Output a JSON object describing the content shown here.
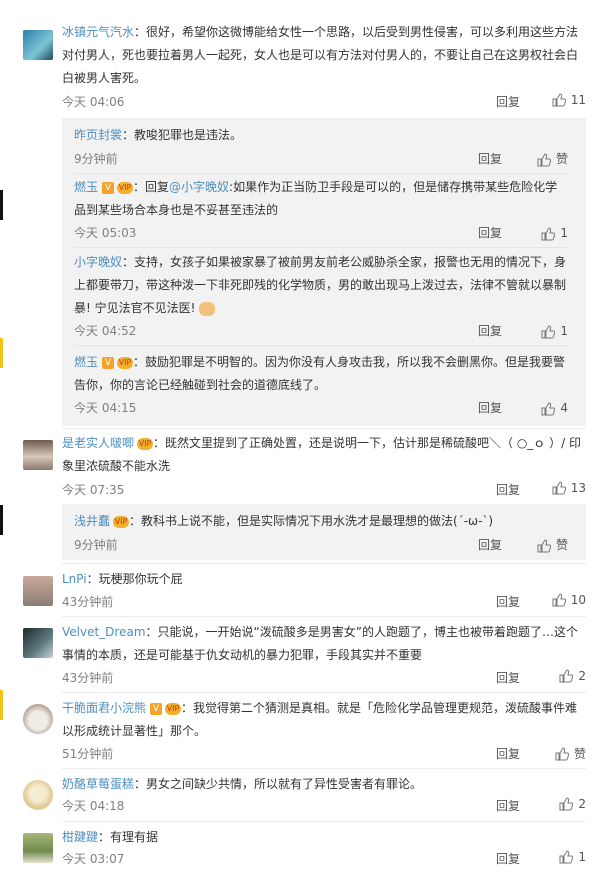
{
  "ui": {
    "reply": "回复",
    "zan": "赞"
  },
  "comments": [
    {
      "name": "冰镇元气汽水",
      "text": "：很好，希望你这微博能给女性一个思路，以后受到男性侵害，可以多利用这些方法对付男人，死也要拉着男人一起死，女人也是可以有方法对付男人的，不要让自己在这男权社会白白被男人害死。",
      "time": "今天 04:06",
      "likes": "11",
      "replies": [
        {
          "name": "昨页封裳",
          "text": "：教唆犯罪也是违法。",
          "time": "9分钟前",
          "likes": "赞"
        },
        {
          "name": "燃玉",
          "text": "：回复",
          "mention": "@小字晚奴",
          "text2": ":如果作为正当防卫手段是可以的，但是储存携带某些危险化学品到某些场合本身也是不妥甚至违法的",
          "time": "今天 05:03",
          "likes": "1"
        },
        {
          "name": "小字晚奴",
          "text": "：支持，女孩子如果被家暴了被前男友前老公威胁杀全家，报警也无用的情况下，身上都要带刀，带这种泼一下非死即残的化学物质，男的敢出现马上泼过去，法律不管就以暴制暴! 宁见法官不见法医!",
          "time": "今天 04:52",
          "likes": "1"
        },
        {
          "name": "燃玉",
          "text": "：鼓励犯罪是不明智的。因为你没有人身攻击我，所以我不会删黑你。但是我要警告你，你的言论已经触碰到社会的道德底线了。",
          "time": "今天 04:15",
          "likes": "4"
        }
      ]
    },
    {
      "name": "是老实人啵唧",
      "text": "：既然文里提到了正确处置，还是说明一下，估计那是稀硫酸吧＼（ ○_ｏ ）/ 印象里浓硫酸不能水洗",
      "time": "今天 07:35",
      "likes": "13",
      "replies": [
        {
          "name": "浅井蠢",
          "text": "：教科书上说不能，但是实际情况下用水洗才是最理想的做法(´-ω-`)",
          "time": "9分钟前",
          "likes": "赞"
        }
      ]
    },
    {
      "name": "LnPi",
      "text": "：玩梗那你玩个屁",
      "time": "43分钟前",
      "likes": "10"
    },
    {
      "name": "Velvet_Dream",
      "text": "：只能说，一开始说“泼硫酸多是男害女”的人跑题了，博主也被带着跑题了…这个事情的本质，还是可能基于仇女动机的暴力犯罪，手段其实并不重要",
      "time": "43分钟前",
      "likes": "2"
    },
    {
      "name": "干脆面君小浣熊",
      "text": "：我觉得第二个猜测是真相。就是「危险化学品管理更规范，泼硫酸事件难以形成统计显著性」那个。",
      "time": "51分钟前",
      "likes": "回复"
    },
    {
      "name": "奶酪草莓蛋糕",
      "text": "：男女之间缺少共情，所以就有了异性受害者有罪论。",
      "time": "今天 04:18",
      "likes": "2"
    },
    {
      "name": "柑踺踺",
      "text": "：有理有据",
      "time": "今天 03:07",
      "likes": "1"
    }
  ]
}
